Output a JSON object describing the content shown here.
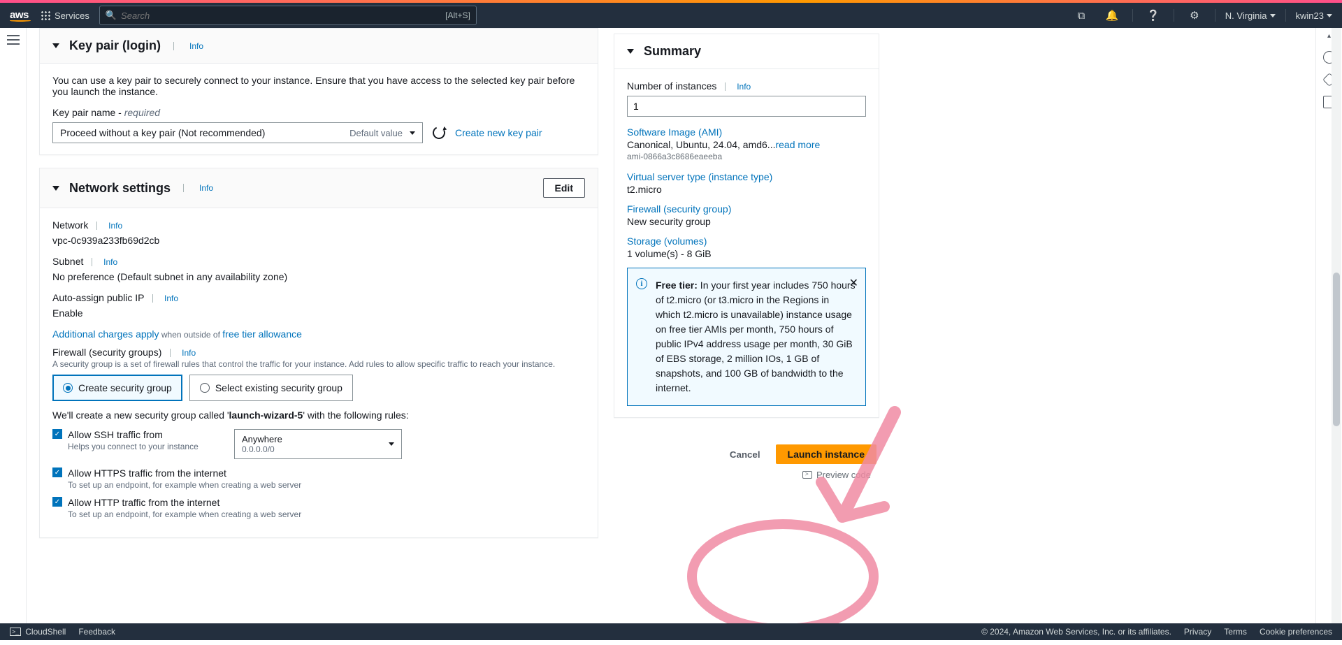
{
  "header": {
    "logo": "aws",
    "services": "Services",
    "search_placeholder": "Search",
    "search_kbd": "[Alt+S]",
    "region": "N. Virginia",
    "user": "kwin23"
  },
  "keypair": {
    "title": "Key pair (login)",
    "info": "Info",
    "desc": "You can use a key pair to securely connect to your instance. Ensure that you have access to the selected key pair before you launch the instance.",
    "name_label": "Key pair name - ",
    "required": "required",
    "select_value": "Proceed without a key pair (Not recommended)",
    "select_placeholder": "Default value",
    "create_link": "Create new key pair"
  },
  "network": {
    "title": "Network settings",
    "info": "Info",
    "edit": "Edit",
    "network_label": "Network",
    "network_val": "vpc-0c939a233fb69d2cb",
    "subnet_label": "Subnet",
    "subnet_val": "No preference (Default subnet in any availability zone)",
    "autoip_label": "Auto-assign public IP",
    "autoip_val": "Enable",
    "charges_link": "Additional charges apply",
    "charges_mid": " when outside of ",
    "charges_tail": "free tier allowance",
    "fw_label": "Firewall (security groups)",
    "fw_desc": "A security group is a set of firewall rules that control the traffic for your instance. Add rules to allow specific traffic to reach your instance.",
    "sg_create": "Create security group",
    "sg_select": "Select existing security group",
    "sg_msg_pre": "We'll create a new security group called '",
    "sg_name": "launch-wizard-5",
    "sg_msg_post": "' with the following rules:",
    "ssh_label": "Allow SSH traffic from",
    "ssh_sub": "Helps you connect to your instance",
    "ssh_sel_top": "Anywhere",
    "ssh_sel_bot": "0.0.0.0/0",
    "https_label": "Allow HTTPS traffic from the internet",
    "https_sub": "To set up an endpoint, for example when creating a web server",
    "http_label": "Allow HTTP traffic from the internet",
    "http_sub": "To set up an endpoint, for example when creating a web server"
  },
  "summary": {
    "title": "Summary",
    "num_label": "Number of instances",
    "info": "Info",
    "num_val": "1",
    "ami_label": "Software Image (AMI)",
    "ami_val": "Canonical, Ubuntu, 24.04, amd6...",
    "read_more": "read more",
    "ami_id": "ami-0866a3c8686eaeeba",
    "type_label": "Virtual server type (instance type)",
    "type_val": "t2.micro",
    "fw_label": "Firewall (security group)",
    "fw_val": "New security group",
    "storage_label": "Storage (volumes)",
    "storage_val": "1 volume(s) - 8 GiB",
    "notice_bold": "Free tier:",
    "notice_body": " In your first year includes 750 hours of t2.micro (or t3.micro in the Regions in which t2.micro is unavailable) instance usage on free tier AMIs per month, 750 hours of public IPv4 address usage per month, 30 GiB of EBS storage, 2 million IOs, 1 GB of snapshots, and 100 GB of bandwidth to the internet.",
    "cancel": "Cancel",
    "launch": "Launch instance",
    "preview": "Preview code"
  },
  "footer": {
    "cloudshell": "CloudShell",
    "feedback": "Feedback",
    "copyright": "© 2024, Amazon Web Services, Inc. or its affiliates.",
    "privacy": "Privacy",
    "terms": "Terms",
    "cookies": "Cookie preferences"
  }
}
